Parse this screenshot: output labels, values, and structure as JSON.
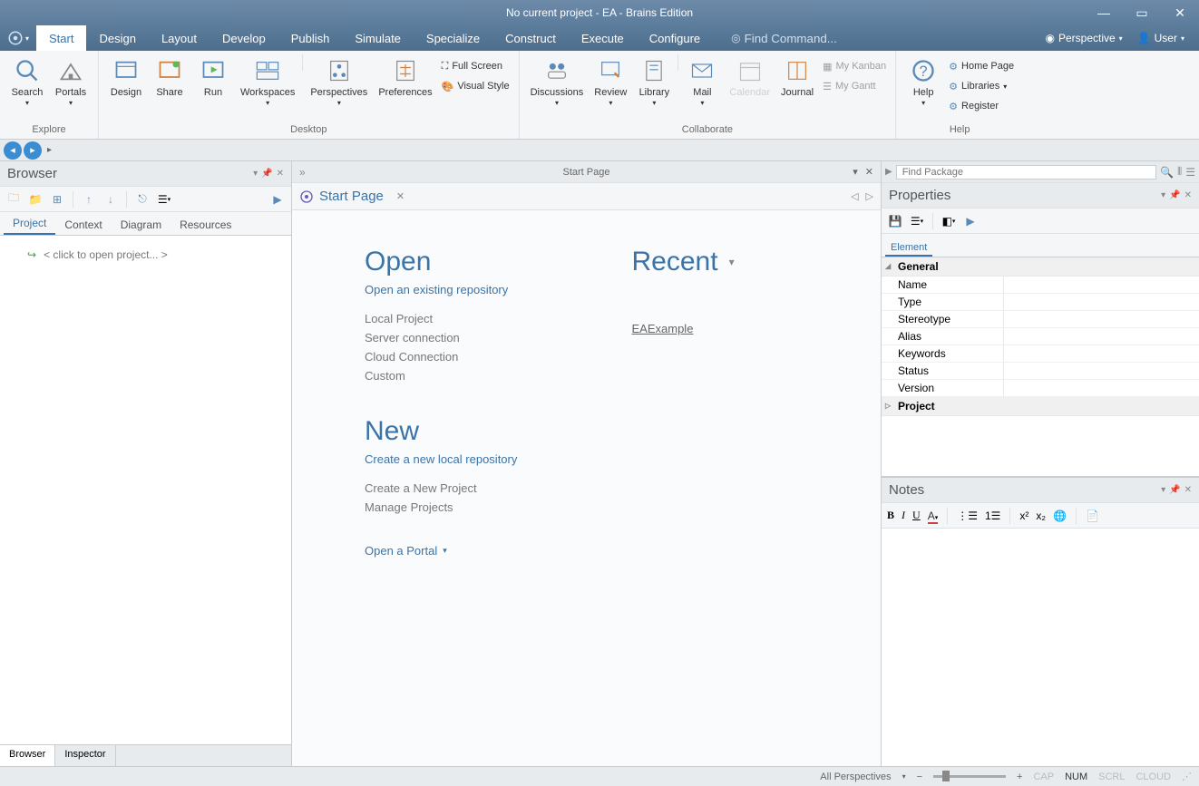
{
  "titlebar": {
    "title": "No current project - EA - Brains Edition"
  },
  "menu": {
    "tabs": [
      "Start",
      "Design",
      "Layout",
      "Develop",
      "Publish",
      "Simulate",
      "Specialize",
      "Construct",
      "Execute",
      "Configure"
    ],
    "find_placeholder": "Find Command...",
    "perspective": "Perspective",
    "user": "User"
  },
  "ribbon": {
    "groups": {
      "explore": {
        "label": "Explore",
        "search": "Search",
        "portals": "Portals"
      },
      "desktop": {
        "label": "Desktop",
        "design": "Design",
        "share": "Share",
        "run": "Run",
        "workspaces": "Workspaces",
        "perspectives": "Perspectives",
        "preferences": "Preferences",
        "fullscreen": "Full Screen",
        "visualstyle": "Visual Style"
      },
      "collaborate": {
        "label": "Collaborate",
        "discussions": "Discussions",
        "review": "Review",
        "library": "Library",
        "mail": "Mail",
        "calendar": "Calendar",
        "journal": "Journal",
        "mykanban": "My Kanban",
        "mygantt": "My Gantt"
      },
      "help": {
        "label": "Help",
        "help": "Help",
        "homepage": "Home Page",
        "libraries": "Libraries",
        "register": "Register"
      }
    }
  },
  "browser": {
    "title": "Browser",
    "tabs": [
      "Project",
      "Context",
      "Diagram",
      "Resources"
    ],
    "placeholder": "< click to open project... >",
    "bottom_tabs": [
      "Browser",
      "Inspector"
    ]
  },
  "startpage": {
    "tab_label": "Start Page",
    "title": "Start Page",
    "open": {
      "h": "Open",
      "sub": "Open an existing repository",
      "items": [
        "Local Project",
        "Server connection",
        "Cloud Connection",
        "Custom"
      ]
    },
    "new": {
      "h": "New",
      "sub": "Create a new local repository",
      "items": [
        "Create a New Project",
        "Manage Projects"
      ]
    },
    "recent": {
      "h": "Recent",
      "items": [
        "EAExample"
      ]
    },
    "portal": "Open a Portal"
  },
  "properties": {
    "title": "Properties",
    "find_placeholder": "Find Package",
    "tab": "Element",
    "groups": [
      {
        "name": "General",
        "expanded": true,
        "rows": [
          "Name",
          "Type",
          "Stereotype",
          "Alias",
          "Keywords",
          "Status",
          "Version"
        ]
      },
      {
        "name": "Project",
        "expanded": false,
        "rows": []
      }
    ]
  },
  "notes": {
    "title": "Notes"
  },
  "statusbar": {
    "perspectives": "All Perspectives",
    "cap": "CAP",
    "num": "NUM",
    "scrl": "SCRL",
    "cloud": "CLOUD"
  }
}
